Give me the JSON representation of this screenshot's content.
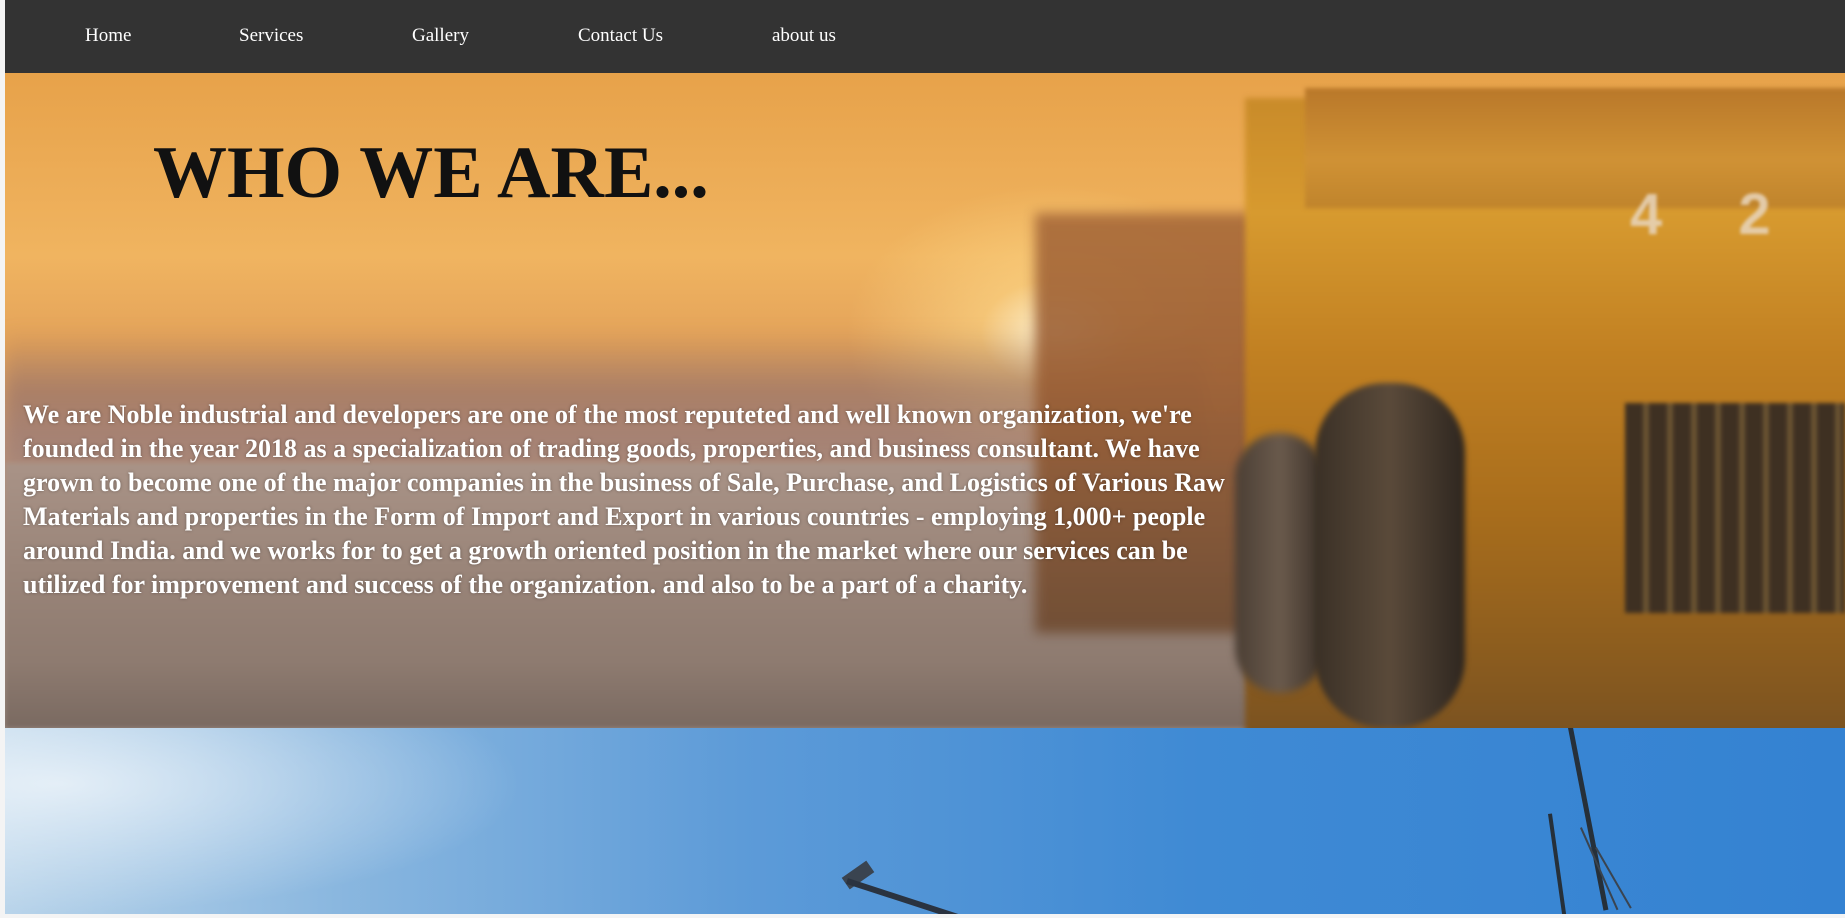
{
  "nav": {
    "items": [
      {
        "label": "Home"
      },
      {
        "label": "Services"
      },
      {
        "label": "Gallery"
      },
      {
        "label": "Contact Us"
      },
      {
        "label": "about us"
      }
    ]
  },
  "hero": {
    "title": "WHO WE ARE...",
    "description": "We are Noble industrial and developers are one of the most reputeted and well known organization, we're founded in the year 2018 as a specialization of trading goods, properties, and business consultant. We have grown to become one of the major companies in the business of Sale, Purchase, and Logistics of Various Raw Materials and properties in the Form of Import and Export in various countries - employing 1,000+ people around India. and we works for to get a growth oriented position in the market where our services can be utilized for improvement and success of the organization. and also to be a part of a charity.",
    "background_image": "mining-dump-trucks-at-sunset",
    "truck_number": "4 2"
  },
  "section2": {
    "background_image": "construction-cranes-blue-sky"
  },
  "colors": {
    "nav_background": "#333333",
    "nav_text": "#ffffff",
    "title_text": "#111111",
    "body_text": "#ffffff"
  }
}
